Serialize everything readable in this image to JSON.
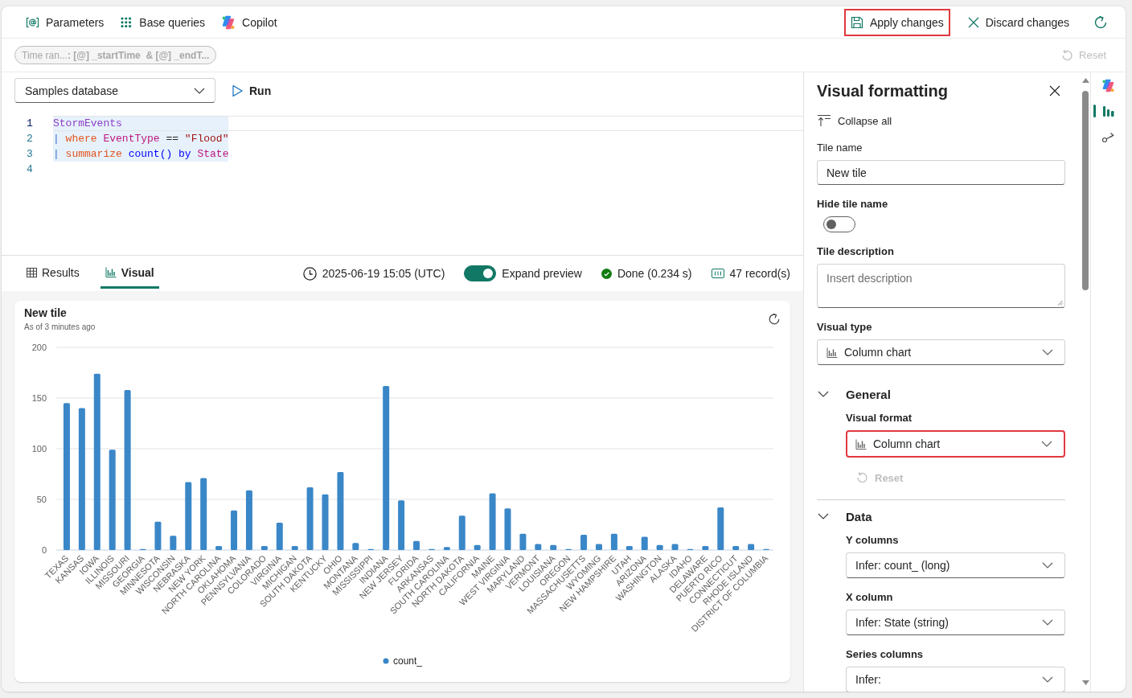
{
  "toolbar": {
    "left_items": [
      {
        "kind": "parameters",
        "label": "Parameters"
      },
      {
        "kind": "base_queries",
        "label": "Base queries"
      },
      {
        "kind": "copilot",
        "label": "Copilot"
      }
    ],
    "right_items": [
      {
        "kind": "save",
        "label": "Apply changes",
        "highlighted": true
      },
      {
        "kind": "discard",
        "label": "Discard changes",
        "highlighted": false
      },
      {
        "kind": "refresh",
        "highlighted": false
      }
    ]
  },
  "parameter_bar": {
    "pills": [
      {
        "text": "Time ran...**: [@] _startTime  & [@] _endT...**",
        "disabled": true
      }
    ],
    "reset": {
      "label": "Reset",
      "disabled": true
    }
  },
  "query": {
    "database": "Samples database",
    "run_label": "Run",
    "lines": [
      {
        "number": "1",
        "current": true,
        "selected": true,
        "tokens": [
          {
            "kind": "table",
            "text": "StormEvents"
          }
        ]
      },
      {
        "number": "2",
        "current": false,
        "selected": true,
        "tokens": [
          {
            "kind": "pipe",
            "text": "| "
          },
          {
            "kind": "keyword",
            "text": "where "
          },
          {
            "kind": "column",
            "text": "EventType "
          },
          {
            "kind": "operator",
            "text": "== "
          },
          {
            "kind": "string",
            "text": "\"Flood\""
          }
        ]
      },
      {
        "number": "3",
        "current": false,
        "selected": true,
        "tokens": [
          {
            "kind": "pipe",
            "text": "| "
          },
          {
            "kind": "keyword",
            "text": "summarize "
          },
          {
            "kind": "function",
            "text": "count() "
          },
          {
            "kind": "function",
            "text": "by "
          },
          {
            "kind": "column",
            "text": "State"
          }
        ]
      },
      {
        "number": "4",
        "current": false,
        "selected": false
      }
    ]
  },
  "results": {
    "tabs": [
      {
        "kind": "table",
        "label": "Results",
        "selected": false
      },
      {
        "kind": "chart",
        "label": "Visual",
        "selected": true
      }
    ],
    "timestamp": "2025-06-19 15:05 (UTC)",
    "expand_preview": {
      "label": "Expand preview",
      "on": true
    },
    "status": "Done (0.234 s)",
    "records": "47 record(s)"
  },
  "tile": {
    "title": "New tile",
    "subtitle": "As of 3 minutes ago",
    "chart_data": {
      "type": "bar",
      "categories": [
        "TEXAS",
        "KANSAS",
        "IOWA",
        "ILLINOIS",
        "MISSOURI",
        "GEORGIA",
        "MINNESOTA",
        "WISCONSIN",
        "NEBRASKA",
        "NEW YORK",
        "NORTH CAROLINA",
        "OKLAHOMA",
        "PENNSYLVANIA",
        "COLORADO",
        "VIRGINIA",
        "MICHIGAN",
        "SOUTH DAKOTA",
        "KENTUCKY",
        "OHIO",
        "MONTANA",
        "MISSISSIPPI",
        "INDIANA",
        "NEW JERSEY",
        "FLORIDA",
        "ARKANSAS",
        "SOUTH CAROLINA",
        "NORTH DAKOTA",
        "CALIFORNIA",
        "MAINE",
        "WEST VIRGINIA",
        "MARYLAND",
        "VERMONT",
        "LOUISIANA",
        "OREGON",
        "MASSACHUSETTS",
        "WYOMING",
        "NEW HAMPSHIRE",
        "UTAH",
        "ARIZONA",
        "WASHINGTON",
        "ALASKA",
        "IDAHO",
        "DELAWARE",
        "PUERTO RICO",
        "CONNECTICUT",
        "RHODE ISLAND",
        "DISTRICT OF COLUMBIA"
      ],
      "series": [
        {
          "name": "count_",
          "color": "#3a87c8",
          "values": [
            145,
            140,
            174,
            99,
            158,
            1,
            28,
            14,
            67,
            71,
            4,
            39,
            59,
            4,
            27,
            4,
            62,
            55,
            77,
            7,
            1,
            162,
            49,
            9,
            1,
            3,
            34,
            5,
            56,
            41,
            16,
            6,
            5,
            1,
            15,
            6,
            16,
            4,
            13,
            5,
            6,
            1,
            4,
            42,
            4,
            6,
            1
          ]
        }
      ],
      "ylim": [
        0,
        200
      ],
      "yticks": [
        0,
        50,
        100,
        150,
        200
      ],
      "grid": true
    }
  },
  "formatting_panel": {
    "title": "Visual formatting",
    "collapse_all": "Collapse all",
    "fields": [
      {
        "kind": "text",
        "label": "Tile name",
        "value": "New tile"
      },
      {
        "kind": "toggle",
        "label": "Hide tile name",
        "on": false
      },
      {
        "kind": "textarea",
        "label": "Tile description",
        "placeholder": "Insert description"
      },
      {
        "kind": "chart_dropdown",
        "label": "Visual type",
        "value": "Column chart"
      }
    ],
    "sections": [
      {
        "title": "General",
        "expanded": true,
        "fields": [
          {
            "kind": "chart_dropdown",
            "label": "Visual format",
            "value": "Column chart",
            "highlighted": true
          }
        ],
        "reset": {
          "label": "Reset",
          "disabled": true
        }
      },
      {
        "title": "Data",
        "expanded": true,
        "fields": [
          {
            "kind": "dropdown",
            "label": "Y columns",
            "value": "Infer: count_ (long)",
            "highlighted": false
          },
          {
            "kind": "dropdown",
            "label": "X column",
            "value": "Infer: State (string)",
            "highlighted": false
          },
          {
            "kind": "dropdown",
            "label": "Series columns",
            "value": "Infer:",
            "highlighted": false
          }
        ]
      }
    ]
  },
  "side_rail": {
    "items": [
      {
        "kind": "copilot",
        "selected": false
      },
      {
        "kind": "chart",
        "selected": true
      },
      {
        "kind": "connector",
        "selected": false
      }
    ]
  }
}
